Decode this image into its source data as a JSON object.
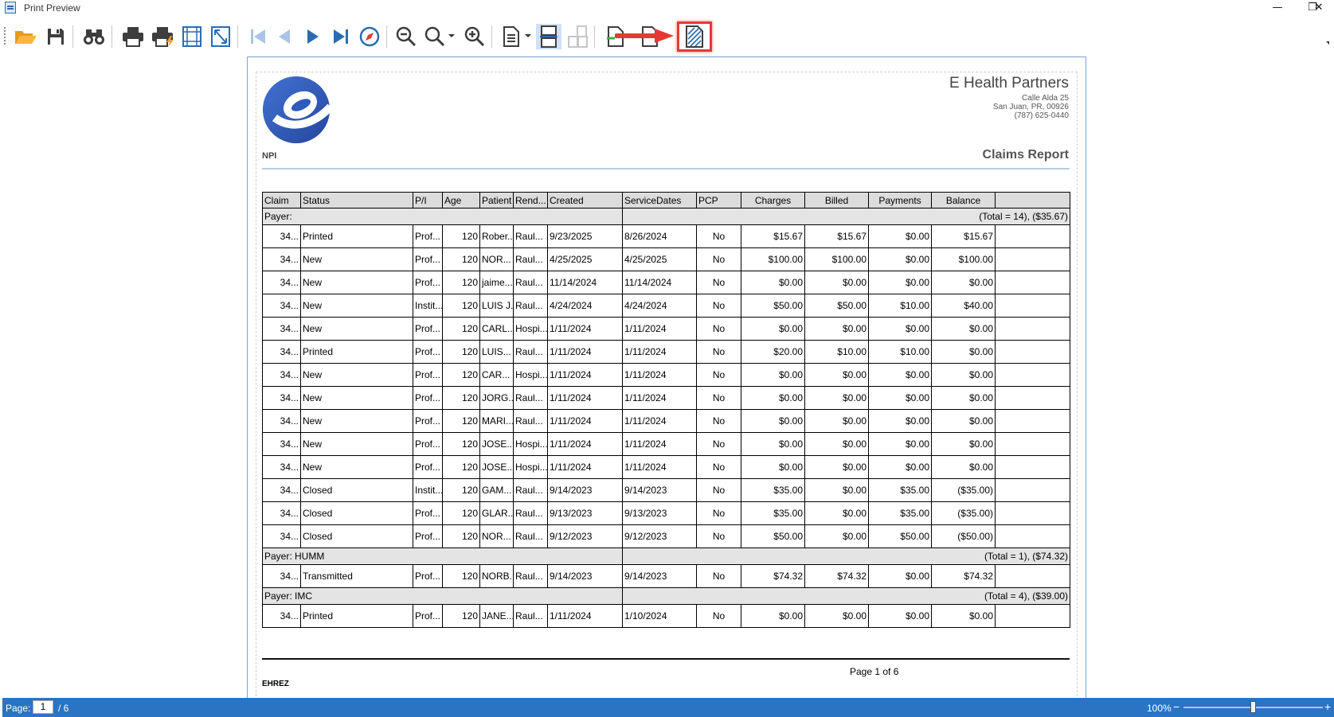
{
  "window": {
    "title": "Print Preview",
    "controls": [
      "—",
      "❐",
      "✕"
    ]
  },
  "toolbar": {
    "buttons": [
      {
        "name": "open-icon"
      },
      {
        "name": "save-icon"
      },
      {
        "name": "find-icon"
      },
      {
        "name": "print-icon"
      },
      {
        "name": "quick-print-icon"
      },
      {
        "name": "page-setup-icon"
      },
      {
        "name": "scale-icon"
      },
      {
        "name": "first-page-icon"
      },
      {
        "name": "previous-page-icon"
      },
      {
        "name": "next-page-icon"
      },
      {
        "name": "last-page-icon"
      },
      {
        "name": "navigation-pane-icon"
      },
      {
        "name": "zoom-out-icon"
      },
      {
        "name": "zoom-icon"
      },
      {
        "name": "zoom-in-icon"
      },
      {
        "name": "single-page-icon"
      },
      {
        "name": "continuous-view-icon"
      },
      {
        "name": "multiple-pages-icon"
      },
      {
        "name": "export-document-icon"
      },
      {
        "name": "send-email-icon"
      },
      {
        "name": "watermark-icon"
      }
    ],
    "highlighted": "watermark-icon",
    "annotation_color": "#e53935"
  },
  "report": {
    "company": "E Health Partners",
    "address_line1": "Calle Alda 25",
    "address_line2": "San Juan, PR, 00926",
    "phone": "(787) 625-0440",
    "npi_label": "NPI",
    "title": "Claims Report",
    "columns": [
      "Claim",
      "Status",
      "P/I",
      "Age",
      "Patient",
      "Rend...",
      "Created",
      "ServiceDates",
      "PCP",
      "Charges",
      "Billed",
      "Payments",
      "Balance"
    ],
    "groups": [
      {
        "label": "Payer:",
        "total": "(Total = 14), ($35.67)",
        "rows": [
          [
            "34...",
            "Printed",
            "Prof...",
            "120",
            "Rober...",
            "Raul...",
            "9/23/2025",
            "8/26/2024",
            "No",
            "$15.67",
            "$15.67",
            "$0.00",
            "$15.67"
          ],
          [
            "34...",
            "New",
            "Prof...",
            "120",
            "NOR...",
            "Raul...",
            "4/25/2025",
            "4/25/2025",
            "No",
            "$100.00",
            "$100.00",
            "$0.00",
            "$100.00"
          ],
          [
            "34...",
            "New",
            "Prof...",
            "120",
            "jaime...",
            "Raul...",
            "11/14/2024",
            "11/14/2024",
            "No",
            "$0.00",
            "$0.00",
            "$0.00",
            "$0.00"
          ],
          [
            "34...",
            "New",
            "Instit...",
            "120",
            "LUIS J...",
            "Raul...",
            "4/24/2024",
            "4/24/2024",
            "No",
            "$50.00",
            "$50.00",
            "$10.00",
            "$40.00"
          ],
          [
            "34...",
            "New",
            "Prof...",
            "120",
            "CARL...",
            "Hospi...",
            "1/11/2024",
            "1/11/2024",
            "No",
            "$0.00",
            "$0.00",
            "$0.00",
            "$0.00"
          ],
          [
            "34...",
            "Printed",
            "Prof...",
            "120",
            "LUIS...",
            "Raul...",
            "1/11/2024",
            "1/11/2024",
            "No",
            "$20.00",
            "$10.00",
            "$10.00",
            "$0.00"
          ],
          [
            "34...",
            "New",
            "Prof...",
            "120",
            "CAR...",
            "Hospi...",
            "1/11/2024",
            "1/11/2024",
            "No",
            "$0.00",
            "$0.00",
            "$0.00",
            "$0.00"
          ],
          [
            "34...",
            "New",
            "Prof...",
            "120",
            "JORG...",
            "Raul...",
            "1/11/2024",
            "1/11/2024",
            "No",
            "$0.00",
            "$0.00",
            "$0.00",
            "$0.00"
          ],
          [
            "34...",
            "New",
            "Prof...",
            "120",
            "MARI...",
            "Raul...",
            "1/11/2024",
            "1/11/2024",
            "No",
            "$0.00",
            "$0.00",
            "$0.00",
            "$0.00"
          ],
          [
            "34...",
            "New",
            "Prof...",
            "120",
            "JOSE...",
            "Hospi...",
            "1/11/2024",
            "1/11/2024",
            "No",
            "$0.00",
            "$0.00",
            "$0.00",
            "$0.00"
          ],
          [
            "34...",
            "New",
            "Prof...",
            "120",
            "JOSE...",
            "Hospi...",
            "1/11/2024",
            "1/11/2024",
            "No",
            "$0.00",
            "$0.00",
            "$0.00",
            "$0.00"
          ],
          [
            "34...",
            "Closed",
            "Instit...",
            "120",
            "GAM...",
            "Raul...",
            "9/14/2023",
            "9/14/2023",
            "No",
            "$35.00",
            "$0.00",
            "$35.00",
            "($35.00)"
          ],
          [
            "34...",
            "Closed",
            "Prof...",
            "120",
            "GLAR...",
            "Raul...",
            "9/13/2023",
            "9/13/2023",
            "No",
            "$35.00",
            "$0.00",
            "$35.00",
            "($35.00)"
          ],
          [
            "34...",
            "Closed",
            "Prof...",
            "120",
            "NOR...",
            "Raul...",
            "9/12/2023",
            "9/12/2023",
            "No",
            "$50.00",
            "$0.00",
            "$50.00",
            "($50.00)"
          ]
        ]
      },
      {
        "label": "Payer: HUMM",
        "total": "(Total = 1), ($74.32)",
        "rows": [
          [
            "34...",
            "Transmitted",
            "Prof...",
            "120",
            "NORB...",
            "Raul...",
            "9/14/2023",
            "9/14/2023",
            "No",
            "$74.32",
            "$74.32",
            "$0.00",
            "$74.32"
          ]
        ]
      },
      {
        "label": "Payer: IMC",
        "total": "(Total = 4), ($39.00)",
        "rows": [
          [
            "34...",
            "Printed",
            "Prof...",
            "120",
            "JANE...",
            "Raul...",
            "1/11/2024",
            "1/10/2024",
            "No",
            "$0.00",
            "$0.00",
            "$0.00",
            "$0.00"
          ]
        ]
      }
    ],
    "page_label": "Page 1 of 6",
    "footer_user": "EHREZ"
  },
  "status": {
    "page_label": "Page:",
    "page_value": "1",
    "page_total": "/ 6",
    "zoom": "100%",
    "zoom_fraction": 0.5
  }
}
